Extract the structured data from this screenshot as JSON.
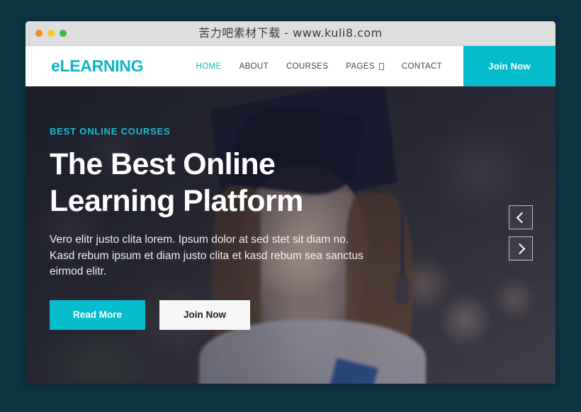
{
  "window": {
    "title": "苦力吧素材下载 - www.kuli8.com",
    "traffic_lights": [
      {
        "name": "close",
        "color": "#f6891f"
      },
      {
        "name": "minimize",
        "color": "#f3cc2b"
      },
      {
        "name": "maximize",
        "color": "#3cba4b"
      }
    ]
  },
  "navbar": {
    "logo": "eLEARNING",
    "links": [
      {
        "label": "HOME",
        "active": true,
        "has_dropdown": false
      },
      {
        "label": "ABOUT",
        "active": false,
        "has_dropdown": false
      },
      {
        "label": "COURSES",
        "active": false,
        "has_dropdown": false
      },
      {
        "label": "PAGES",
        "active": false,
        "has_dropdown": true
      },
      {
        "label": "CONTACT",
        "active": false,
        "has_dropdown": false
      }
    ],
    "cta_label": "Join Now"
  },
  "hero": {
    "eyebrow": "BEST ONLINE COURSES",
    "title": "The Best Online\nLearning Platform",
    "paragraph": "Vero elitr justo clita lorem. Ipsum dolor at sed stet sit diam no. Kasd rebum ipsum et diam justo clita et kasd rebum sea sanctus eirmod elitr.",
    "primary_button": "Read More",
    "secondary_button": "Join Now",
    "carousel": {
      "prev_icon": "chevron-left-icon",
      "next_icon": "chevron-right-icon"
    }
  },
  "colors": {
    "page_background": "#0d3442",
    "accent_teal": "#06bccd",
    "titlebar": "#dedede",
    "nav_text": "#3f4750"
  }
}
